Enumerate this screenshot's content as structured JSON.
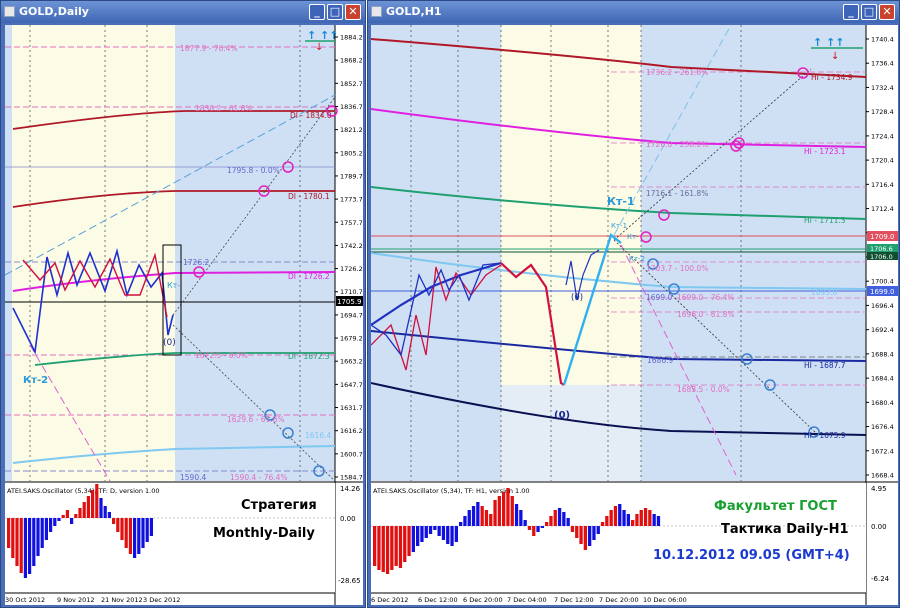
{
  "left_window": {
    "title": "GOLD,Daily",
    "price_axis": [
      "1884.2",
      "1868.2",
      "1852.7",
      "1836.7",
      "1821.2",
      "1805.2",
      "1789.7",
      "1773.7",
      "1757.7",
      "1742.2",
      "1726.2",
      "1710.7",
      "1694.7",
      "1679.2",
      "1663.2",
      "1647.7",
      "1631.7",
      "1616.2",
      "1600.7",
      "1584.7"
    ],
    "current_price": "1705.9",
    "levels": {
      "l1": "1877.9 - 76.4%",
      "l2": "1838.2 - 61.8%",
      "l3": "DI - 1834.0",
      "l4": "1795.8 - 0.0%",
      "l5": "DI - 1780.1",
      "l6": "1726.2",
      "l7": "DI - 1726.2",
      "l8": "1672.5 - 0.0%",
      "l9": "DI - 1672.3",
      "l10": "1629.6 - 61.8%",
      "l11": "1616.4",
      "l12": "1590.4",
      "l13": "1590.4 - 76.4%"
    },
    "labels": {
      "kt2": "Кт-2",
      "kt": "Кт-",
      "zero": "(0)"
    },
    "oscillator": {
      "header": "ATEI.SAKS.Oscillator (5,34), TF: D, version 1.00",
      "max": "14.26",
      "mid": "0.00",
      "min": "-28.65",
      "text1": "Стратегия",
      "text2": "Monthly-Daily"
    },
    "date_axis": [
      "30 Oct 2012",
      "9 Nov 2012",
      "21 Nov 2012",
      "3 Dec 2012"
    ]
  },
  "right_window": {
    "title": "GOLD,H1",
    "price_axis": [
      "1740.4",
      "1736.4",
      "1732.4",
      "1728.4",
      "1724.4",
      "1720.4",
      "1716.4",
      "1712.4",
      "1708.4",
      "1704.4",
      "1700.4",
      "1696.4",
      "1692.4",
      "1688.4",
      "1684.4",
      "1680.4",
      "1676.4",
      "1672.4",
      "1668.4"
    ],
    "price_flags": {
      "red": "1709.0",
      "green1": "1706.6",
      "green2": "1706.0",
      "blue": "1699.0"
    },
    "levels": {
      "l1": "1736.2 - 261.8%",
      "l2": "HI - 1734.9",
      "l3": "1726.0 - 238.0%",
      "l4": "HI - 1723.1",
      "l5": "1716.1 - 161.8%",
      "l6": "HI - 1711.3",
      "l7": "1703.7 - 100.0%",
      "l8": "1699.0",
      "l9": "1699.0 - 76.4%",
      "l10": "1693.8",
      "l11": "1696.0 - 61.8%",
      "l12": "1686.9",
      "l13": "HI - 1687.7",
      "l14": "1683.5 - 0.0%",
      "l15": "HI - 1675.9"
    },
    "labels": {
      "kt1": "Кт-1",
      "kt1b": "Кт-1",
      "kt2": "Кт-2",
      "kt": "Кт-",
      "zero_small": "(0)",
      "zero_big": "(0)"
    },
    "oscillator": {
      "header": "ATEI.SAKS.Oscillator (5,34), TF: H1, version 1.00",
      "max": "4.95",
      "mid": "0.00",
      "min": "-6.24",
      "text1": "Факультет ГОСТ",
      "text2": "Тактика Daily-H1",
      "text3": "10.12.2012 09.05 (GMT+4)"
    },
    "date_axis": [
      "6 Dec 2012",
      "6 Dec 12:00",
      "6 Dec 20:00",
      "7 Dec 04:00",
      "7 Dec 12:00",
      "7 Dec 20:00",
      "10 Dec 06:00"
    ]
  },
  "colors": {
    "chart_bg_blue": "#cfe0f5",
    "chart_bg_yellow": "#fbfbe6",
    "darkred": "#b01828",
    "magenta": "#e020e0",
    "green": "#20a070",
    "darkblue": "#1a2a90",
    "lightblue": "#7fc8f0",
    "osc_red": "#e01010",
    "osc_blue": "#1010e0"
  }
}
